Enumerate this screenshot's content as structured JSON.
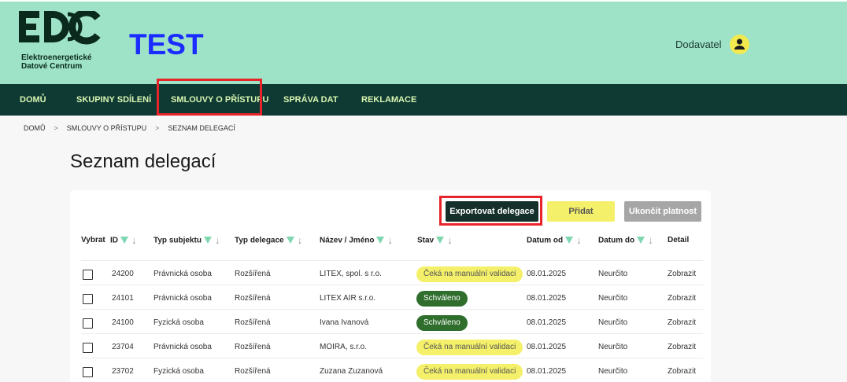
{
  "header": {
    "logo_mark": "EDC",
    "logo_line1": "Elektroenergetické",
    "logo_line2": "Datové Centrum",
    "environment_label": "TEST",
    "user_name": "Dodavatel"
  },
  "nav": {
    "items": [
      "DOMŮ",
      "SKUPINY SDÍLENÍ",
      "SMLOUVY O PŘÍSTUPU",
      "SPRÁVA DAT",
      "REKLAMACE"
    ],
    "highlight_color": "#e8232a"
  },
  "breadcrumb": [
    "DOMŮ",
    "SMLOUVY O PŘÍSTUPU",
    "SEZNAM DELEGACÍ"
  ],
  "page_title": "Seznam delegací",
  "toolbar": {
    "export_label": "Exportovat delegace",
    "add_label": "Přidat",
    "end_label": "Ukončit platnost"
  },
  "table": {
    "columns": [
      "Vybrat",
      "ID",
      "Typ subjektu",
      "Typ delegace",
      "Název / Jméno",
      "Stav",
      "Datum od",
      "Datum do",
      "Detail"
    ],
    "rows": [
      {
        "id": "24200",
        "subject": "Právnická osoba",
        "type": "Rozšířená",
        "name": "LITEX, spol. s r.o.",
        "status": "Čeká na manuální validaci",
        "status_kind": "wait",
        "from": "08.01.2025",
        "to": "Neurčito",
        "detail": "Zobrazit"
      },
      {
        "id": "24101",
        "subject": "Právnická osoba",
        "type": "Rozšířená",
        "name": "LITEX AIR s.r.o.",
        "status": "Schváleno",
        "status_kind": "ok",
        "from": "08.01.2025",
        "to": "Neurčito",
        "detail": "Zobrazit"
      },
      {
        "id": "24100",
        "subject": "Fyzická osoba",
        "type": "Rozšířená",
        "name": "Ivana Ivanová",
        "status": "Schváleno",
        "status_kind": "ok",
        "from": "08.01.2025",
        "to": "Neurčito",
        "detail": "Zobrazit"
      },
      {
        "id": "23704",
        "subject": "Právnická osoba",
        "type": "Rozšířená",
        "name": "MOIRA, s.r.o.",
        "status": "Čeká na manuální validaci",
        "status_kind": "wait",
        "from": "08.01.2025",
        "to": "Neurčito",
        "detail": "Zobrazit"
      },
      {
        "id": "23702",
        "subject": "Fyzická osoba",
        "type": "Rozšířená",
        "name": "Zuzana Zuzanová",
        "status": "Čeká na manuální validaci",
        "status_kind": "wait",
        "from": "08.01.2025",
        "to": "Neurčito",
        "detail": "Zobrazit"
      }
    ]
  },
  "colors": {
    "header_bg": "#9ee3c8",
    "nav_bg": "#0f3a34",
    "nav_text": "#d8f5b0",
    "test_label": "#1a2cff",
    "status_wait": "#f4f06a",
    "status_ok": "#2f6e2d",
    "filter_icon": "#7fd6b0"
  }
}
